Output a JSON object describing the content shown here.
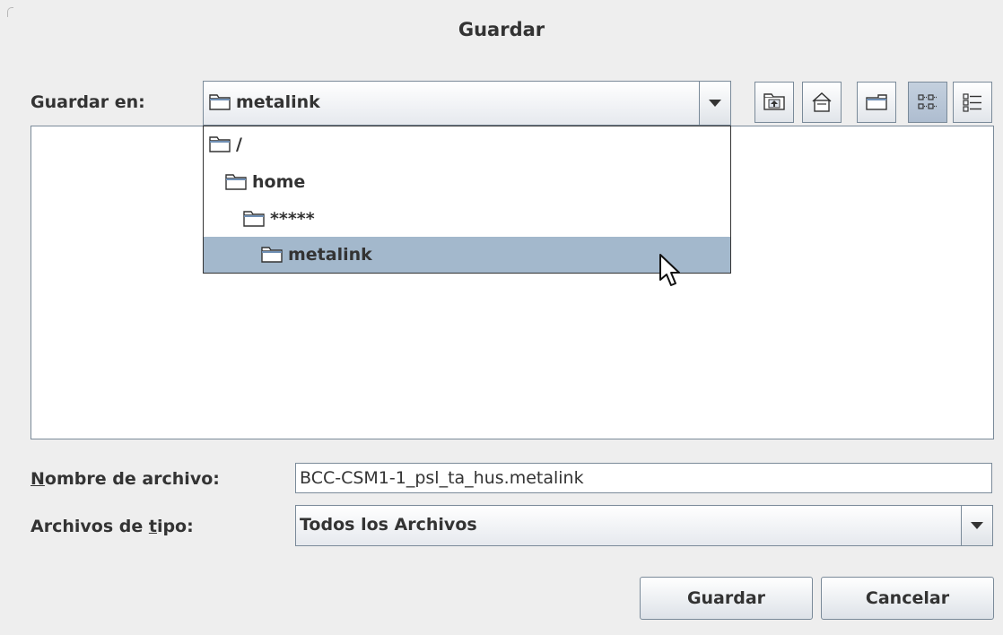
{
  "dialog": {
    "title": "Guardar"
  },
  "save_in": {
    "label": "Guardar en:",
    "selected": "metalink",
    "icon": "folder-icon"
  },
  "toolbar": [
    {
      "name": "up-one-level-button",
      "icon": "folder-up-icon"
    },
    {
      "name": "home-button",
      "icon": "home-icon"
    },
    {
      "name": "new-folder-button",
      "icon": "new-folder-icon"
    },
    {
      "name": "list-view-button",
      "icon": "list-view-icon",
      "selected": true
    },
    {
      "name": "details-view-button",
      "icon": "details-view-icon"
    }
  ],
  "path_dropdown": {
    "items": [
      {
        "label": "/",
        "level": 0,
        "selected": false
      },
      {
        "label": "home",
        "level": 1,
        "selected": false
      },
      {
        "label": "*****",
        "level": 2,
        "selected": false
      },
      {
        "label": "metalink",
        "level": 3,
        "selected": true
      }
    ]
  },
  "filename": {
    "label_mnemonic": "N",
    "label_rest": "ombre de archivo:",
    "value": "BCC-CSM1-1_psl_ta_hus.metalink"
  },
  "file_type": {
    "label_pre": "Archivos de ",
    "label_mnemonic": "t",
    "label_post": "ipo:",
    "selected": "Todos los Archivos"
  },
  "buttons": {
    "save": "Guardar",
    "cancel": "Cancelar"
  },
  "colors": {
    "background": "#eeeeee",
    "selection": "#a3b8cc",
    "border": "#7a8a99",
    "text": "#333333"
  }
}
